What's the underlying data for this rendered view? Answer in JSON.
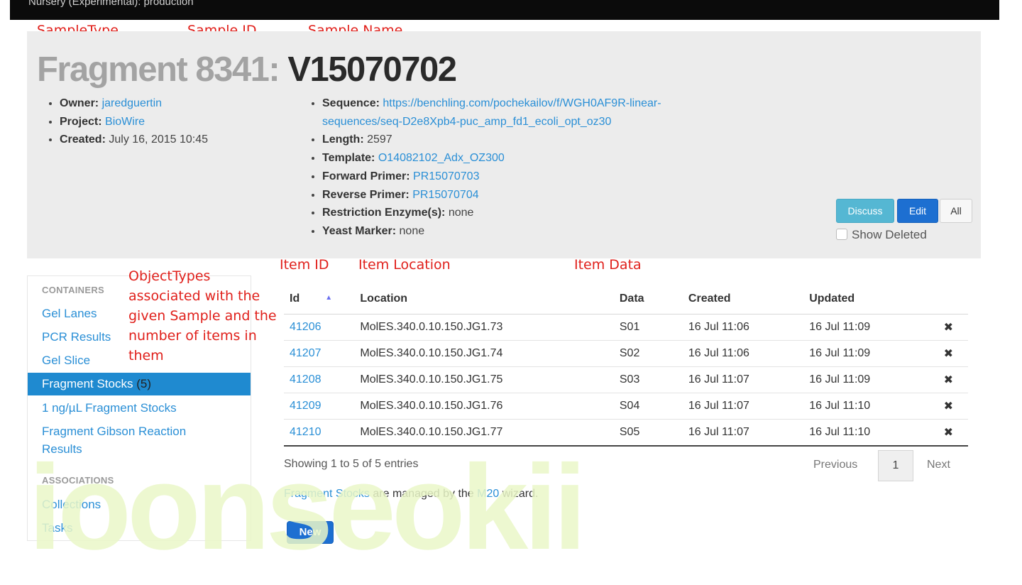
{
  "topbar": {
    "title": "Nursery (Experimental): production"
  },
  "annotations": {
    "sample_type": "SampleType",
    "sample_id": "Sample ID",
    "sample_name": "Sample Name",
    "object_types": [
      "ObjectTypes",
      "associated with the",
      "given Sample and the",
      "number of items in",
      "them"
    ],
    "item_id": "Item ID",
    "item_location": "Item Location",
    "item_data": "Item Data"
  },
  "sample": {
    "type_id": "Fragment 8341:",
    "name": "V15070702",
    "owner_label": "Owner:",
    "owner": "jaredguertin",
    "project_label": "Project:",
    "project": "BioWire",
    "created_label": "Created:",
    "created": "July 16, 2015 10:45",
    "sequence_label": "Sequence:",
    "sequence_line1": "https://benchling.com/pochekailov/f/WGH0AF9R-linear-",
    "sequence_line2": "sequences/seq-D2e8Xpb4-puc_amp_fd1_ecoli_opt_oz30",
    "length_label": "Length:",
    "length": "2597",
    "template_label": "Template:",
    "template": "O14082102_Adx_OZ300",
    "forward_label": "Forward Primer:",
    "forward": "PR15070703",
    "reverse_label": "Reverse Primer:",
    "reverse": "PR15070704",
    "enzyme_label": "Restriction Enzyme(s):",
    "enzyme": "none",
    "yeast_label": "Yeast Marker:",
    "yeast": "none"
  },
  "actions": {
    "discuss": "Discuss",
    "edit": "Edit",
    "all": "All",
    "show_deleted": "Show Deleted"
  },
  "sidebar": {
    "containers_heading": "CONTAINERS",
    "items": [
      {
        "label": "Gel Lanes"
      },
      {
        "label": "PCR Results"
      },
      {
        "label": "Gel Slice"
      },
      {
        "label": "Fragment Stocks",
        "count": "(5)"
      },
      {
        "label": "1 ng/µL Fragment Stocks"
      },
      {
        "label": "Fragment Gibson Reaction Results"
      }
    ],
    "associations_heading": "ASSOCIATIONS",
    "associations": [
      {
        "label": "Collections"
      },
      {
        "label": "Tasks"
      }
    ]
  },
  "table": {
    "headers": {
      "id": "Id",
      "location": "Location",
      "data": "Data",
      "created": "Created",
      "updated": "Updated"
    },
    "rows": [
      {
        "id": "41206",
        "location": "MolES.340.0.10.150.JG1.73",
        "data": "S01",
        "created": "16 Jul 11:06",
        "updated": "16 Jul 11:09"
      },
      {
        "id": "41207",
        "location": "MolES.340.0.10.150.JG1.74",
        "data": "S02",
        "created": "16 Jul 11:06",
        "updated": "16 Jul 11:09"
      },
      {
        "id": "41208",
        "location": "MolES.340.0.10.150.JG1.75",
        "data": "S03",
        "created": "16 Jul 11:07",
        "updated": "16 Jul 11:09"
      },
      {
        "id": "41209",
        "location": "MolES.340.0.10.150.JG1.76",
        "data": "S04",
        "created": "16 Jul 11:07",
        "updated": "16 Jul 11:10"
      },
      {
        "id": "41210",
        "location": "MolES.340.0.10.150.JG1.77",
        "data": "S05",
        "created": "16 Jul 11:07",
        "updated": "16 Jul 11:10"
      }
    ],
    "delete_glyph": "✖"
  },
  "pagination": {
    "showing": "Showing 1 to 5 of 5 entries",
    "previous": "Previous",
    "page": "1",
    "next": "Next"
  },
  "wizard": {
    "link": "Fragment Stocks",
    "text1": " are managed by the ",
    "wizard_name": "M20",
    "text2": " wizard."
  },
  "new_button": "New",
  "watermark": "ioonseokii"
}
